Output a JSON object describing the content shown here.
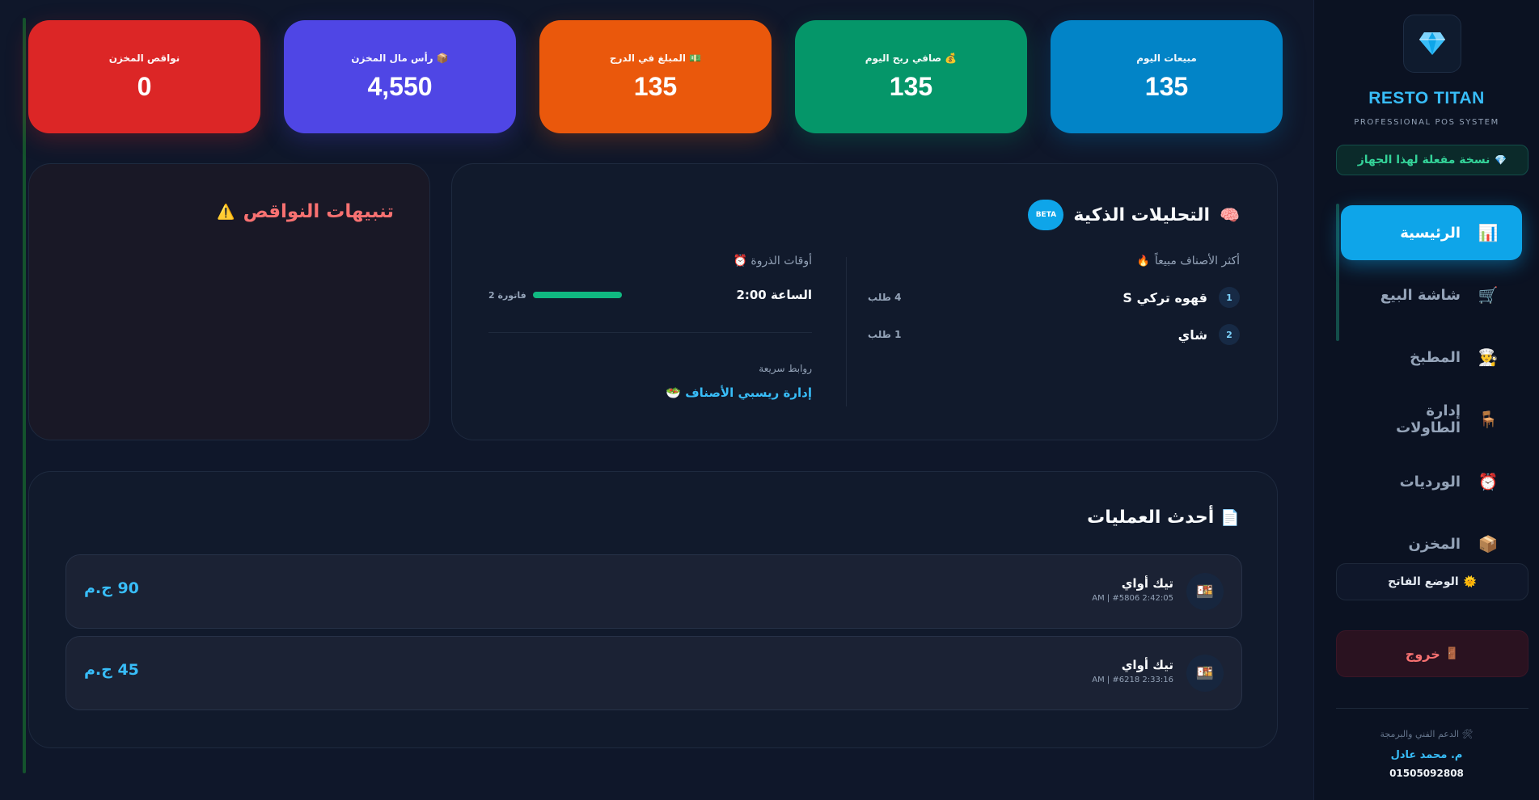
{
  "stats": [
    {
      "label": "مبيعات اليوم",
      "value": "135",
      "color": "#0284c7"
    },
    {
      "label": "صافي ربح اليوم 💰",
      "value": "135",
      "color": "#059669"
    },
    {
      "label": "المبلغ في الدرج 💵",
      "value": "135",
      "color": "#ea580c"
    },
    {
      "label": "رأس مال المخزن 📦",
      "value": "4,550",
      "color": "#4f46e5"
    },
    {
      "label": "نواقص المخزن",
      "value": "0",
      "color": "#dc2626"
    }
  ],
  "alerts": {
    "title": "تنبيهات النواقص",
    "icon": "⚠️"
  },
  "analytics": {
    "title": "التحليلات الذكية",
    "icon": "🧠",
    "badge": "BETA",
    "top_items_title": "أكثر الأصناف مبيعاً",
    "top_items_icon": "🔥",
    "top_items": [
      {
        "rank": "1",
        "name": "قهوه تركي S",
        "count": "4 طلب"
      },
      {
        "rank": "2",
        "name": "شاي",
        "count": "1 طلب"
      }
    ],
    "peak_title": "أوقات الذروة ⏰",
    "peak": {
      "time": "الساعة 2:00",
      "count": "2 فاتورة",
      "level": 1.0
    },
    "quick_links_label": "روابط سريعة",
    "quick_link": "إدارة ريسبي الأصناف 🥗"
  },
  "operations": {
    "title": "أحدث العمليات",
    "icon": "📄",
    "rows": [
      {
        "name": "تيك أواي",
        "meta": "AM | #5806 2:42:05",
        "amount": "90 ج.م",
        "icon": "🍱"
      },
      {
        "name": "تيك أواي",
        "meta": "AM | #6218 2:33:16",
        "amount": "45 ج.م",
        "icon": "🍱"
      }
    ]
  },
  "sidebar": {
    "brand": "RESTO TITAN",
    "subtitle": "PROFESSIONAL POS SYSTEM",
    "license": "نسخة مفعلة لهذا الجهاز",
    "license_icon": "💎",
    "nav": [
      {
        "label": "الرئيسية",
        "icon": "📊",
        "active": true
      },
      {
        "label": "شاشة البيع",
        "icon": "🛒",
        "active": false
      },
      {
        "label": "المطبخ",
        "icon": "👨‍🍳",
        "active": false
      },
      {
        "label": "إدارة الطاولات",
        "icon": "🪑",
        "active": false
      },
      {
        "label": "الورديات",
        "icon": "⏰",
        "active": false
      },
      {
        "label": "المخزن",
        "icon": "📦",
        "active": false
      }
    ],
    "mode_label": "الوضع الفاتح",
    "mode_icon": "🌞",
    "logout_label": "خروج",
    "logout_icon": "🚪",
    "support_label": "الدعم الفني والبرمجة 🛠",
    "developer": "م. محمد عادل",
    "phone": "01505092808"
  },
  "colors": {
    "accent": "#0ea5e9",
    "success": "#10b981",
    "danger": "#f87171",
    "background": "#0f172a"
  }
}
